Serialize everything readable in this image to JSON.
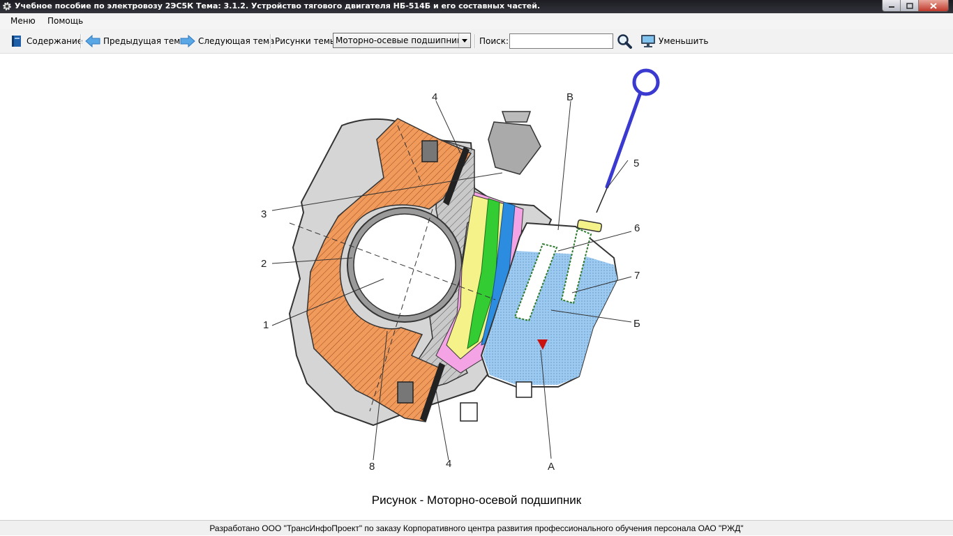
{
  "window": {
    "title": "Учебное пособие по электровозу 2ЭС5К Тема: 3.1.2. Устройство тягового двигателя НБ-514Б и его составных частей."
  },
  "menu": {
    "items": [
      "Меню",
      "Помощь"
    ]
  },
  "toolbar": {
    "contents_label": "Содержание",
    "prev_label": "Предыдущая тема",
    "next_label": "Следующая тема",
    "figures_label": "Рисунки темы",
    "figures_selected": "Моторно-осевые подшипники",
    "search_label": "Поиск:",
    "search_value": "",
    "shrink_label": "Уменьшить"
  },
  "figure": {
    "labels": {
      "l1": "1",
      "l2": "2",
      "l3": "3",
      "l4a": "4",
      "l4b": "4",
      "l5": "5",
      "l6": "6",
      "l7": "7",
      "l8": "8",
      "lA": "А",
      "lB": "Б",
      "lV": "В"
    },
    "colors": {
      "housing": "#d3d3d3",
      "bronze_liner": "#f09a5c",
      "oil": "#9ccaf0",
      "wick_yellow": "#f6f28a",
      "wick_green": "#33cc33",
      "wick_blue": "#2b8ce0",
      "wick_pink": "#f4a4e4",
      "dipstick": "#3a3ad0"
    }
  },
  "caption": "Рисунок - Моторно-осевой подшипник",
  "footer": "Разработано ООО \"ТрансИнфоПроект\" по заказу Корпоративного центра развития профессионального обучения персонала ОАО \"РЖД\""
}
